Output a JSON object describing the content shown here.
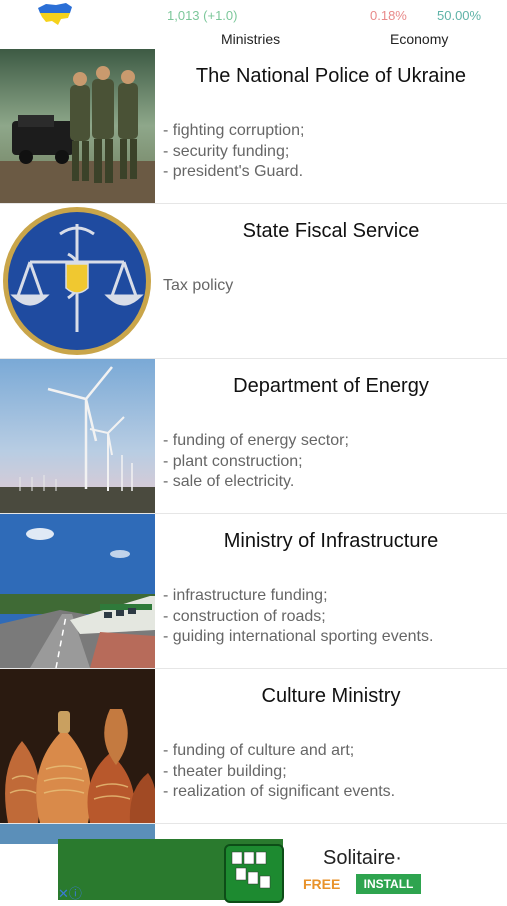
{
  "header": {
    "stat_ministries": "1,013 (+1.0)",
    "stat_economy_pct": "0.18%",
    "stat_other_pct": "50.00%",
    "label_ministries": "Ministries",
    "label_economy": "Economy"
  },
  "ministries": [
    {
      "title": "The National Police of Ukraine",
      "desc": "- fighting corruption;\n- security funding;\n- president's Guard."
    },
    {
      "title": "State Fiscal Service",
      "desc": "Tax policy"
    },
    {
      "title": "Department of Energy",
      "desc": "- funding of energy sector;\n- plant construction;\n- sale of electricity."
    },
    {
      "title": "Ministry of Infrastructure",
      "desc": "- infrastructure funding;\n- construction of roads;\n- guiding international sporting events."
    },
    {
      "title": "Culture Ministry",
      "desc": "- funding of culture and art;\n- theater building;\n- realization of significant events."
    }
  ],
  "ad": {
    "title": "Solitaire·",
    "free": "FREE",
    "install": "INSTALL"
  },
  "colors": {
    "green_stat": "#7cc79a",
    "red_stat": "#e88a8a",
    "teal_stat": "#5fb3a8"
  }
}
